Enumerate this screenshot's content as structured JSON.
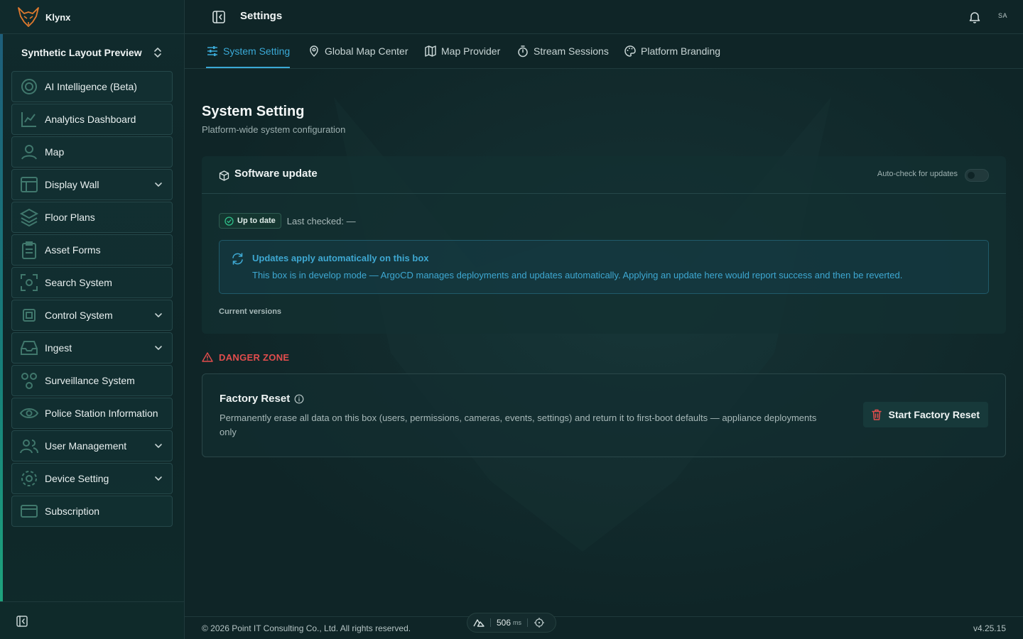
{
  "app": {
    "name": "Klynx",
    "workspace": "Synthetic Layout Preview"
  },
  "header": {
    "title": "Settings",
    "avatar": "SA"
  },
  "sidebar": {
    "items": [
      {
        "label": "AI Intelligence (Beta)",
        "icon": "target-icon",
        "expandable": false
      },
      {
        "label": "Analytics Dashboard",
        "icon": "chart-icon",
        "expandable": false
      },
      {
        "label": "Map",
        "icon": "map-pin-icon",
        "expandable": false
      },
      {
        "label": "Display Wall",
        "icon": "layout-icon",
        "expandable": true
      },
      {
        "label": "Floor Plans",
        "icon": "layers-icon",
        "expandable": false
      },
      {
        "label": "Asset Forms",
        "icon": "clipboard-icon",
        "expandable": false
      },
      {
        "label": "Search System",
        "icon": "scan-icon",
        "expandable": false
      },
      {
        "label": "Control System",
        "icon": "cpu-icon",
        "expandable": true
      },
      {
        "label": "Ingest",
        "icon": "inbox-icon",
        "expandable": true
      },
      {
        "label": "Surveillance System",
        "icon": "network-icon",
        "expandable": false
      },
      {
        "label": "Police Station Information",
        "icon": "eye-icon",
        "expandable": false
      },
      {
        "label": "User Management",
        "icon": "users-icon",
        "expandable": true
      },
      {
        "label": "Device Setting",
        "icon": "gear-icon",
        "expandable": true
      },
      {
        "label": "Subscription",
        "icon": "card-icon",
        "expandable": false
      }
    ]
  },
  "tabs": [
    {
      "label": "System Setting",
      "icon": "sliders-icon",
      "active": true
    },
    {
      "label": "Global Map Center",
      "icon": "map-pin-icon",
      "active": false
    },
    {
      "label": "Map Provider",
      "icon": "map-icon",
      "active": false
    },
    {
      "label": "Stream Sessions",
      "icon": "timer-icon",
      "active": false
    },
    {
      "label": "Platform Branding",
      "icon": "palette-icon",
      "active": false
    }
  ],
  "main": {
    "title": "System Setting",
    "subtitle": "Platform-wide system configuration",
    "software_update": {
      "title": "Software update",
      "auto_check_label": "Auto-check for updates",
      "auto_check_enabled": false,
      "status_badge": "Up to date",
      "last_checked": "Last checked: —",
      "info_title": "Updates apply automatically on this box",
      "info_text": "This box is in develop mode — ArgoCD manages deployments and updates automatically. Applying an update here would report success and then be reverted.",
      "versions_label": "Current versions"
    },
    "danger_zone": {
      "label": "DANGER ZONE",
      "reset_title": "Factory Reset",
      "reset_desc": "Permanently erase all data on this box (users, permissions, cameras, events, settings) and return it to first-boot defaults — appliance deployments only",
      "reset_button": "Start Factory Reset"
    }
  },
  "footer": {
    "copyright": "© 2026 Point IT Consulting Co., Ltd. All rights reserved.",
    "latency": "506",
    "latency_unit": "ms",
    "version": "v4.25.15"
  },
  "colors": {
    "accent": "#3aa9d6",
    "danger": "#e24d4d",
    "success": "#2fbf8a"
  }
}
